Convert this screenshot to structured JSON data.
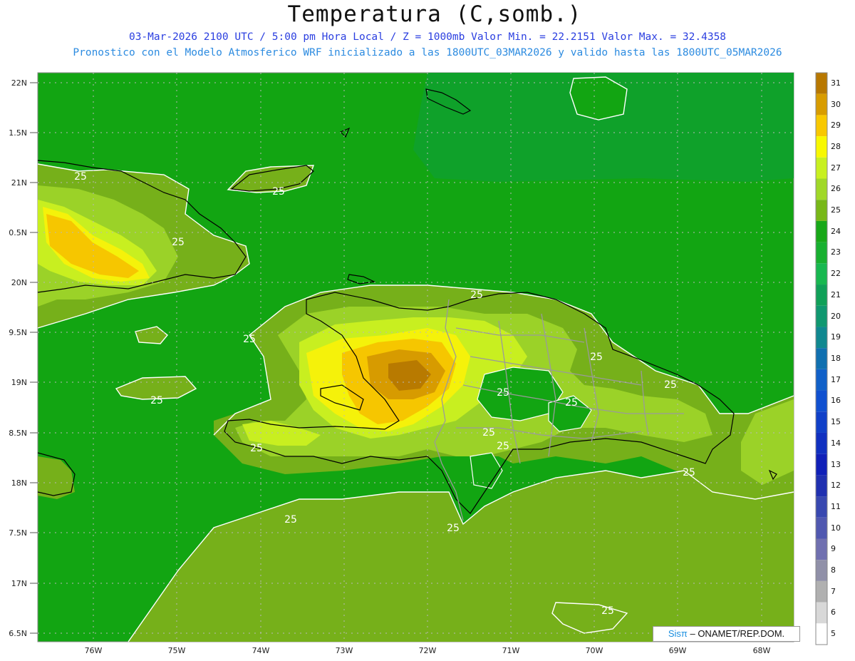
{
  "header": {
    "title": "Temperatura (C,somb.)",
    "line1": "03-Mar-2026 2100 UTC / 5:00 pm Hora Local / Z = 1000mb   Valor Min. = 22.2151  Valor Max. = 32.4358",
    "line2": "Pronostico con el Modelo Atmosferico WRF inicializado a las 1800UTC_03MAR2026 y valido hasta las  1800UTC_05MAR2026"
  },
  "axes": {
    "lat_labels": [
      "22N",
      "1.5N",
      "21N",
      "0.5N",
      "20N",
      "9.5N",
      "19N",
      "8.5N",
      "18N",
      "7.5N",
      "17N",
      "6.5N"
    ],
    "lon_labels": [
      "76W",
      "75W",
      "74W",
      "73W",
      "72W",
      "71W",
      "70W",
      "69W",
      "68W"
    ]
  },
  "contour_labels": [
    "25",
    "25",
    "25",
    "25",
    "25",
    "25",
    "25",
    "25",
    "25",
    "25",
    "25",
    "25",
    "25",
    "25",
    "25"
  ],
  "colorbar": {
    "labels": [
      "31",
      "30",
      "29",
      "28",
      "27",
      "26",
      "25",
      "24",
      "23",
      "22",
      "21",
      "20",
      "19",
      "18",
      "17",
      "16",
      "15",
      "14",
      "13",
      "12",
      "11",
      "10",
      "9",
      "8",
      "7",
      "6",
      "5"
    ],
    "colors": [
      "#b87800",
      "#d89c00",
      "#f8c800",
      "#f8f800",
      "#c8f020",
      "#a0d828",
      "#78b818",
      "#18a818",
      "#18b030",
      "#18b850",
      "#10a058",
      "#109870",
      "#108890",
      "#1070b0",
      "#1060c8",
      "#1050d0",
      "#1040c8",
      "#1030c0",
      "#1020b8",
      "#2030b0",
      "#3848b0",
      "#5058b0",
      "#7070b0",
      "#9090a8",
      "#b0b0b0",
      "#d8d8d8",
      "#ffffff"
    ]
  },
  "credit": {
    "brand": "Sisπ",
    "text": " – ONAMET/REP.DOM."
  },
  "colors": {
    "ocean": "#12a512",
    "fill_25_26": "#76b01a",
    "fill_26_27": "#9bd228",
    "fill_27_28": "#c8ef20",
    "fill_28_29": "#f5f20a",
    "fill_29_30": "#f6c600",
    "fill_30_31": "#d79b00",
    "fill_31_plus": "#b87a00",
    "coast": "#000000",
    "borders": "#9a9a9a"
  }
}
